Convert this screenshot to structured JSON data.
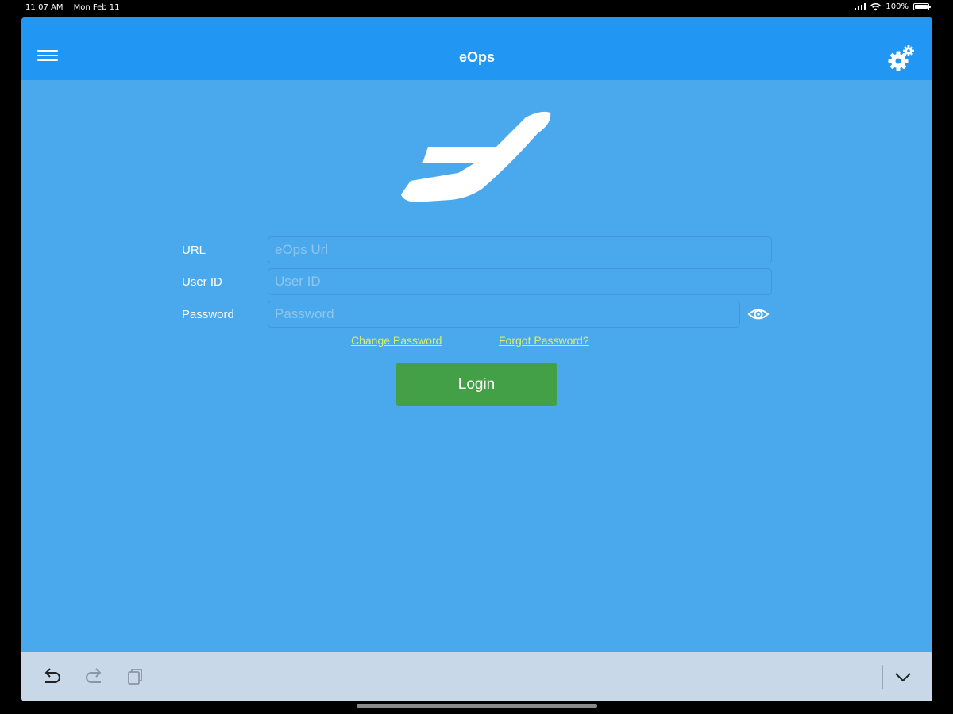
{
  "status_bar": {
    "time": "11:07 AM",
    "date": "Mon Feb 11",
    "battery": "100%"
  },
  "nav": {
    "title": "eOps"
  },
  "form": {
    "url": {
      "label": "URL",
      "placeholder": "eOps Url",
      "value": ""
    },
    "user_id": {
      "label": "User ID",
      "placeholder": "User ID",
      "value": ""
    },
    "password": {
      "label": "Password",
      "placeholder": "Password",
      "value": ""
    }
  },
  "links": {
    "change_password": "Change Password",
    "forgot_password": "Forgot Password?"
  },
  "login_button": {
    "label": "Login"
  },
  "colors": {
    "nav_bar": "#2196f3",
    "background": "#4aa9ec",
    "login_button": "#43a047",
    "link": "#d8ef6e",
    "toolbar": "#c8d8e8"
  },
  "icons": {
    "menu": "hamburger-icon",
    "settings": "gears-icon",
    "logo": "airplane-logo",
    "show_password": "eye-icon",
    "undo": "undo-icon",
    "redo": "redo-icon",
    "paste": "clipboard-icon",
    "collapse": "chevron-down-icon"
  }
}
